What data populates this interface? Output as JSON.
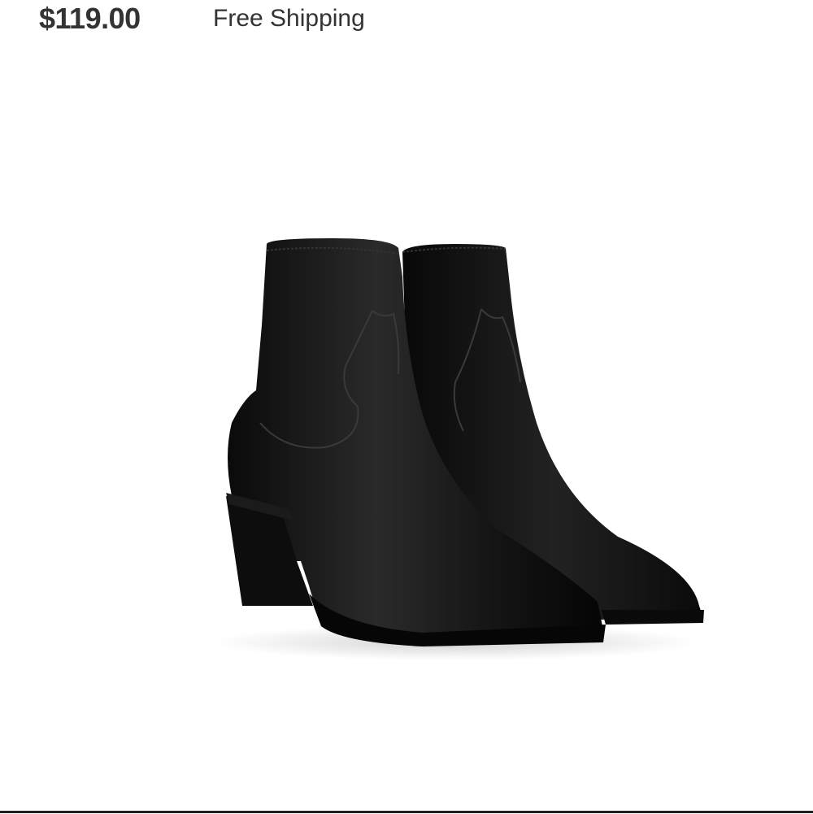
{
  "product": {
    "price": "$119.00",
    "shipping": "Free Shipping",
    "image_icon": "ankle-boot-pair-image",
    "boot_color": "#111111"
  }
}
